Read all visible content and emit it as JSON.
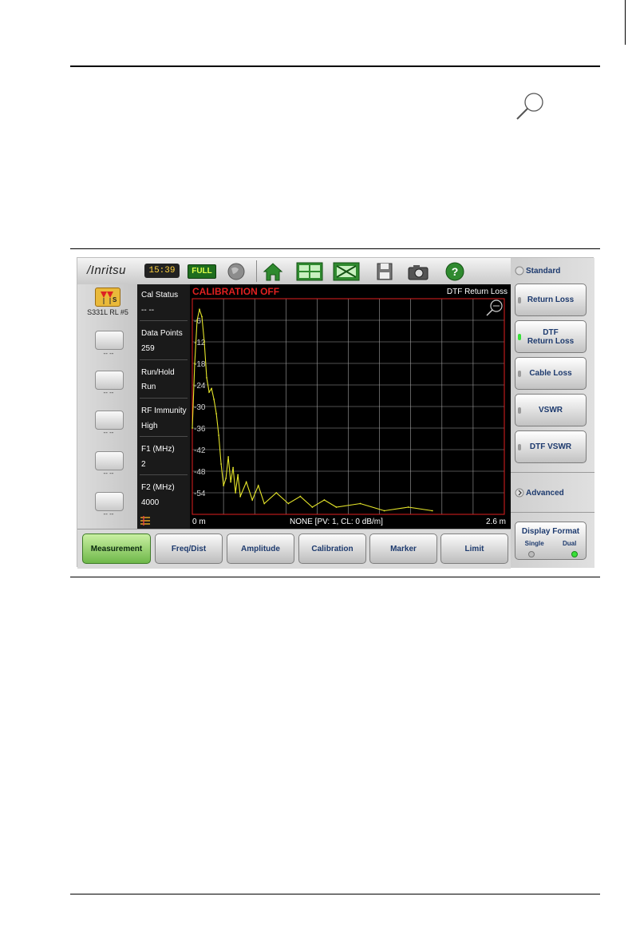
{
  "topbar": {
    "logo": "/Inritsu",
    "clock": "15:39",
    "battery": "FULL",
    "icons": [
      "globe-icon",
      "home-icon",
      "layout-icon",
      "fullscreen-icon",
      "save-icon",
      "camera-icon",
      "help-icon"
    ]
  },
  "left_panel": {
    "instrument": "S331L RL #5",
    "badge": "S",
    "buttons": [
      "-- --",
      "-- --",
      "-- --",
      "-- --",
      "-- --"
    ]
  },
  "info": {
    "items": [
      {
        "label": "Cal Status",
        "value": "-- --"
      },
      {
        "label": "Data Points",
        "value": "259"
      },
      {
        "label": "Run/Hold",
        "value": "Run"
      },
      {
        "label": "RF Immunity",
        "value": "High"
      },
      {
        "label": "F1 (MHz)",
        "value": "2"
      },
      {
        "label": "F2 (MHz)",
        "value": "4000"
      }
    ]
  },
  "plot": {
    "status": "CALIBRATION OFF",
    "trace": "DTF Return Loss",
    "x_start": "0 m",
    "x_end": "2.6 m",
    "footer": "NONE [PV: 1,  CL: 0 dB/m]",
    "y_ticks": [
      "-6",
      "-12",
      "-18",
      "-24",
      "-30",
      "-36",
      "-42",
      "-48",
      "-54"
    ]
  },
  "chart_data": {
    "type": "line",
    "title": "DTF Return Loss",
    "xlabel": "",
    "ylabel": "",
    "xlim": [
      0,
      2.6
    ],
    "ylim": [
      -60,
      0
    ],
    "series": [
      {
        "x": [
          0.0,
          0.02,
          0.04,
          0.06,
          0.08,
          0.1,
          0.12,
          0.14,
          0.16,
          0.18,
          0.2,
          0.22,
          0.24,
          0.26,
          0.28,
          0.3,
          0.32,
          0.34,
          0.36,
          0.38,
          0.4,
          0.45,
          0.5,
          0.55,
          0.6,
          0.7,
          0.8,
          0.9,
          1.0,
          1.1,
          1.2,
          1.4,
          1.6,
          1.8,
          2.0
        ],
        "y": [
          -36,
          -18,
          -6,
          -3,
          -5,
          -12,
          -22,
          -26,
          -25,
          -28,
          -32,
          -38,
          -46,
          -52,
          -50,
          -44,
          -51,
          -47,
          -54,
          -49,
          -55,
          -51,
          -56,
          -52,
          -57,
          -54,
          -57,
          -55,
          -58,
          -56,
          -58,
          -57,
          -59,
          -58,
          -59
        ]
      }
    ]
  },
  "side": {
    "standard": "Standard",
    "buttons": [
      {
        "label": "Return Loss",
        "active": false
      },
      {
        "label": "DTF\nReturn Loss",
        "active": true
      },
      {
        "label": "Cable Loss",
        "active": false
      },
      {
        "label": "VSWR",
        "active": false
      },
      {
        "label": "DTF VSWR",
        "active": false
      }
    ],
    "advanced": "Advanced",
    "display_format": "Display Format",
    "single": "Single",
    "dual": "Dual"
  },
  "bottom": {
    "tabs": [
      "Measurement",
      "Freq/Dist",
      "Amplitude",
      "Calibration",
      "Marker",
      "Limit"
    ]
  },
  "colors": {
    "trace": "#e6e62a",
    "grid": "#a0a0a0",
    "alert": "#e02020",
    "active_tab": "#7ec257"
  }
}
